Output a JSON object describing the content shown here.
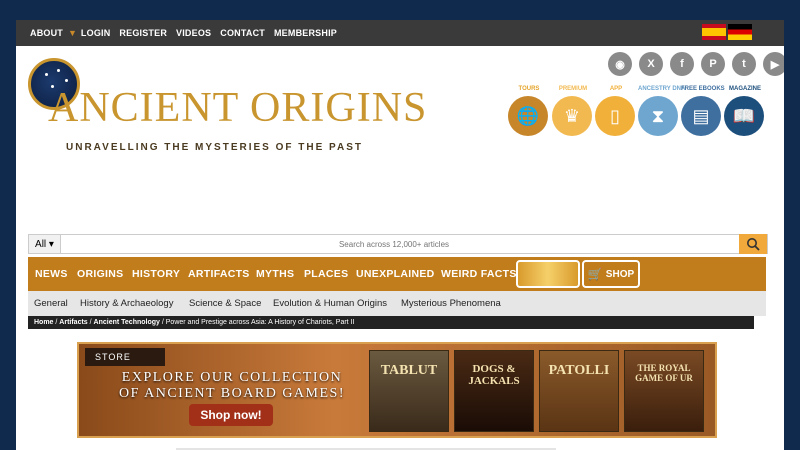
{
  "topnav": {
    "items": [
      "ABOUT",
      "LOGIN",
      "REGISTER",
      "VIDEOS",
      "CONTACT",
      "MEMBERSHIP"
    ]
  },
  "logo": {
    "title": "ANCIENT ORIGINS",
    "tagline": "UNRAVELLING THE MYSTERIES OF THE PAST"
  },
  "social": [
    "rss-icon",
    "x-icon",
    "facebook-icon",
    "pinterest-icon",
    "tumblr-icon",
    "youtube-icon"
  ],
  "categories": [
    {
      "label": "TOURS",
      "icon": "globe-plane-icon",
      "color": "#c8862a"
    },
    {
      "label": "PREMIUM",
      "icon": "crown-icon",
      "color": "#f2b950"
    },
    {
      "label": "APP",
      "icon": "phone-hand-icon",
      "color": "#f0b03a"
    },
    {
      "label": "ANCESTRY DNA",
      "icon": "dna-icon",
      "color": "#6ea6cf"
    },
    {
      "label": "FREE EBOOKS",
      "icon": "ebook-icon",
      "color": "#3f6f9f"
    },
    {
      "label": "MAGAZINE",
      "icon": "book-icon",
      "color": "#1d4f7c"
    }
  ],
  "search": {
    "scope": "All",
    "placeholder": "Search across 12,000+ articles"
  },
  "mainnav": [
    "NEWS",
    "ORIGINS",
    "HISTORY",
    "ARTIFACTS",
    "MYTHS",
    "PLACES",
    "UNEXPLAINED",
    "WEIRD FACTS"
  ],
  "shop_label": "SHOP",
  "subnav": [
    "General",
    "History & Archaeology",
    "Science & Space",
    "Evolution & Human Origins",
    "Mysterious Phenomena"
  ],
  "breadcrumb": {
    "home": "Home",
    "artifacts": "Artifacts",
    "tech": "Ancient Technology",
    "current": "Power and Prestige across Asia: A History of Chariots, Part II"
  },
  "banner": {
    "store": "STORE",
    "line1": "EXPLORE OUR COLLECTION",
    "line2": "OF ANCIENT BOARD GAMES!",
    "cta": "Shop now!",
    "games": [
      "TABLUT",
      "DOGS & JACKALS",
      "PATOLLI",
      "THE ROYAL GAME OF UR"
    ]
  }
}
